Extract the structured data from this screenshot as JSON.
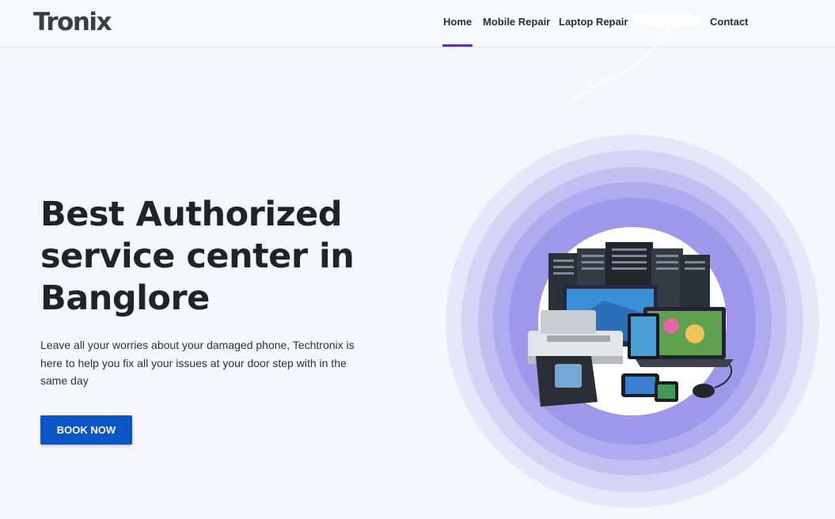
{
  "header": {
    "logo": "Tronix",
    "nav": [
      {
        "label": "Home",
        "active": true
      },
      {
        "label": "Mobile Repair",
        "active": false
      },
      {
        "label": "Laptop Repair",
        "active": false
      },
      {
        "label": "Contact",
        "active": false
      }
    ]
  },
  "hero": {
    "title": "Best Authorized service center in Banglore",
    "description": "Leave all your worries about your damaged phone, Techtronix is here to help you fix all your issues at your door step with in the same day",
    "cta": "BOOK NOW"
  },
  "colors": {
    "accent": "#5f2fb6",
    "button": "#0a56c7",
    "ring_outer": "#e7e6fa",
    "ring_inner": "#9f98ea"
  },
  "illustration": {
    "subject": "electronics-devices",
    "items": [
      "server-rack",
      "printer",
      "monitor",
      "laptop",
      "tablet",
      "smartphone",
      "desk-phone",
      "mouse"
    ]
  }
}
